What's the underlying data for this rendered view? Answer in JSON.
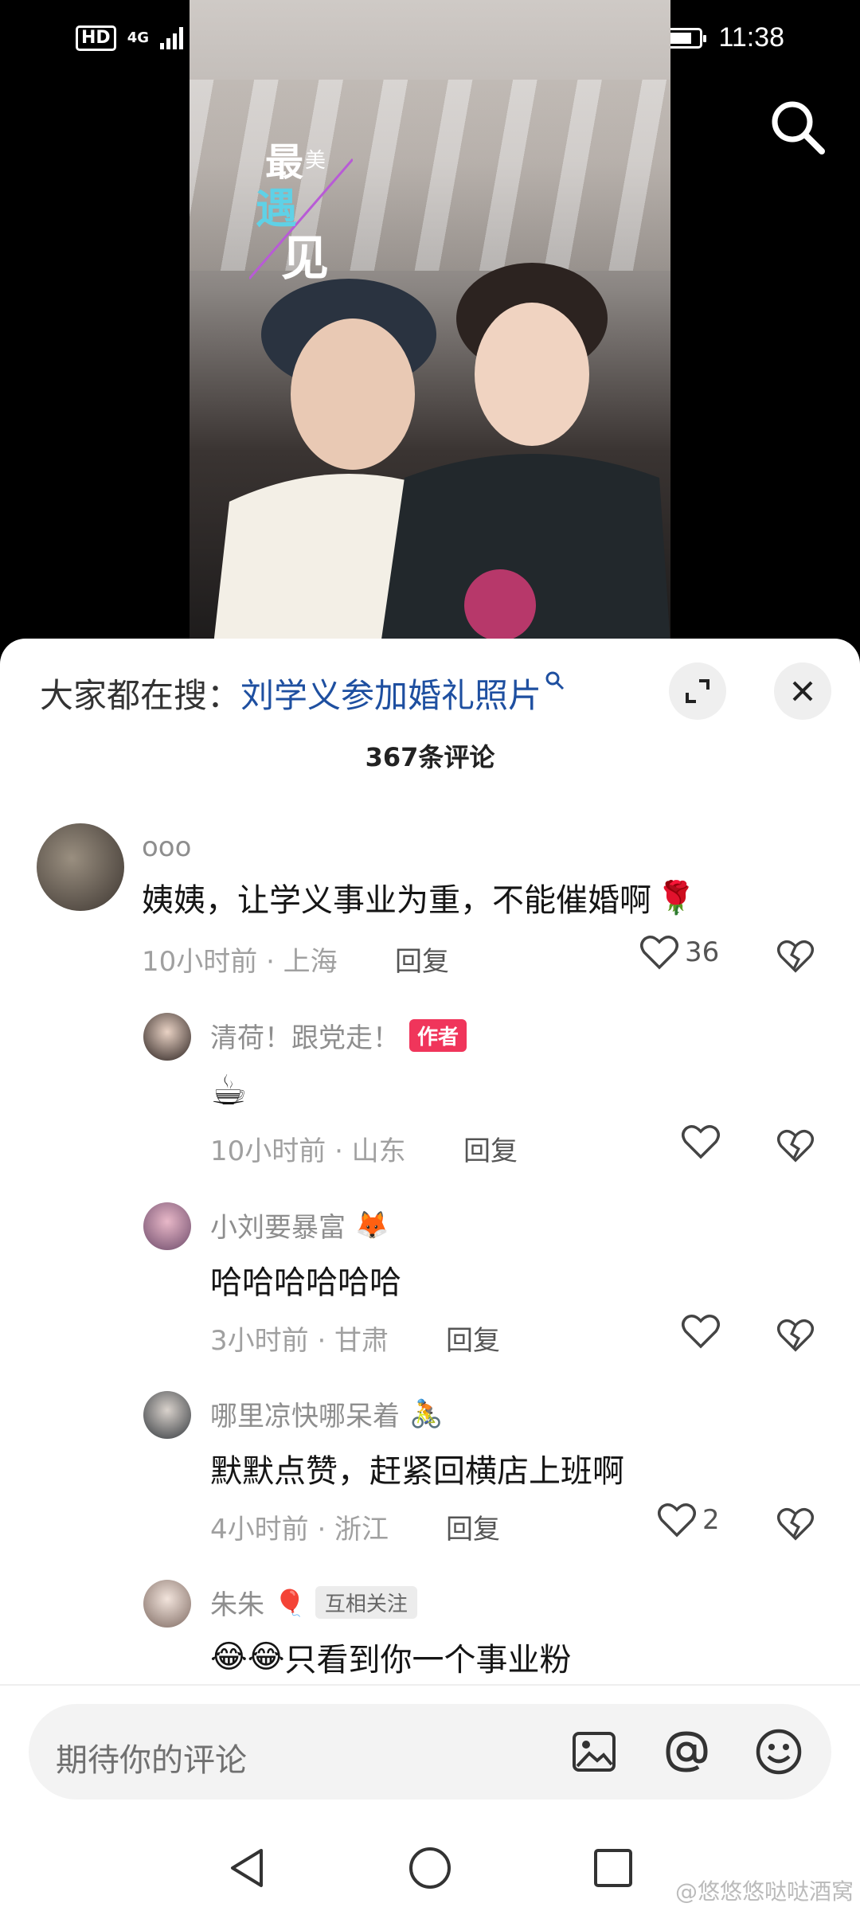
{
  "status_bar": {
    "hd": "HD",
    "network": "4G",
    "time": "11:38"
  },
  "video": {
    "title_text": "最美的遇见"
  },
  "panel": {
    "search_prefix": "大家都在搜：",
    "search_keyword": "刘学义参加婚礼照片",
    "comment_count": "367条评论"
  },
  "comments": [
    {
      "name": "ooo",
      "text": "姨姨，让学义事业为重，不能催婚啊",
      "meta": "10小时前 · 上海",
      "reply": "回复",
      "likes": "36"
    },
    {
      "name": "清荷！跟党走！",
      "tag": "作者",
      "text": "☕",
      "meta": "10小时前 · 山东",
      "reply": "回复",
      "likes": ""
    },
    {
      "name": "小刘要暴富",
      "text": "哈哈哈哈哈哈",
      "meta": "3小时前 · 甘肃",
      "reply": "回复",
      "likes": ""
    },
    {
      "name": "哪里凉快哪呆着",
      "text": "默默点赞，赶紧回横店上班啊",
      "meta": "4小时前 · 浙江",
      "reply": "回复",
      "likes": "2"
    },
    {
      "name": "朱朱",
      "tag": "互相关注",
      "text": "只看到你一个事业粉",
      "meta": "",
      "reply": "",
      "likes": ""
    }
  ],
  "input": {
    "placeholder": "期待你的评论"
  },
  "watermark": "@悠悠悠哒哒酒窝",
  "colors": {
    "accent_link": "#1e4fa0",
    "author_tag": "#f0355b"
  }
}
